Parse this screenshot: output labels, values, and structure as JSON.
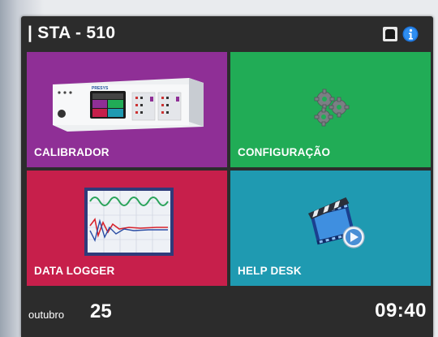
{
  "header": {
    "title": "| STA - 510",
    "icons": [
      "disk-icon",
      "info-icon"
    ]
  },
  "tiles": [
    {
      "label": "CALIBRADOR",
      "color": "#8f2f96",
      "icon": "device-icon"
    },
    {
      "label": "CONFIGURAÇÃO",
      "color": "#21ac56",
      "icon": "gears-icon"
    },
    {
      "label": "DATA LOGGER",
      "color": "#c71f4b",
      "icon": "waveform-icon"
    },
    {
      "label": "HELP DESK",
      "color": "#1f9ab1",
      "icon": "video-icon"
    }
  ],
  "footer": {
    "month": "outubro",
    "day": "25",
    "time": "09:40"
  }
}
